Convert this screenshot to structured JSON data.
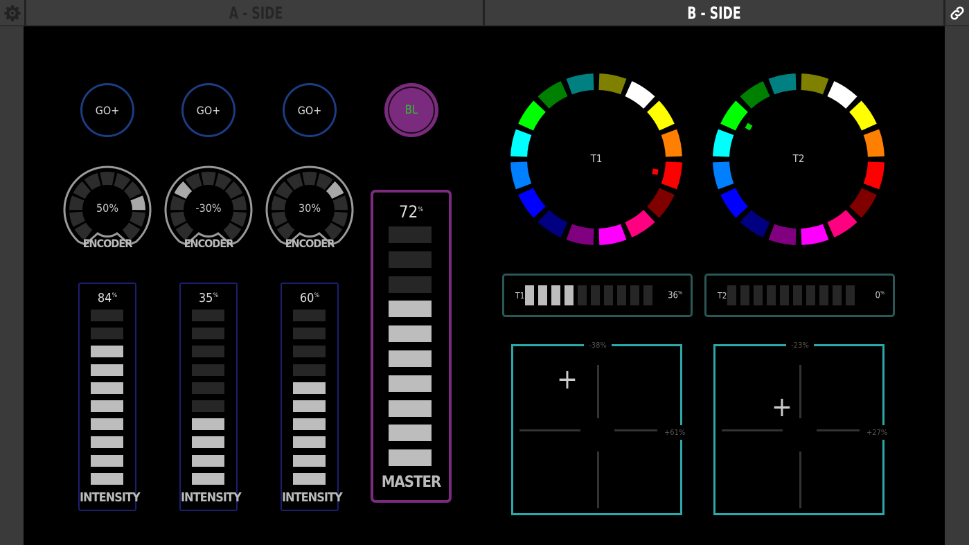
{
  "header": {
    "tab_a": "A - SIDE",
    "tab_b": "B - SIDE",
    "settings_icon": "gear-icon",
    "link_icon": "link-icon"
  },
  "buttons": [
    {
      "label": "GO+"
    },
    {
      "label": "GO+"
    },
    {
      "label": "GO+"
    },
    {
      "label": "BL"
    }
  ],
  "encoders": [
    {
      "value": 50,
      "display": "50%",
      "label": "ENCODER"
    },
    {
      "value": -30,
      "display": "-30%",
      "label": "ENCODER"
    },
    {
      "value": 30,
      "display": "30%",
      "label": "ENCODER"
    }
  ],
  "faders": [
    {
      "value": 84,
      "display": "84",
      "unit": "%",
      "label": "INTENSITY"
    },
    {
      "value": 35,
      "display": "35",
      "unit": "%",
      "label": "INTENSITY"
    },
    {
      "value": 60,
      "display": "60",
      "unit": "%",
      "label": "INTENSITY"
    }
  ],
  "master": {
    "value": 72,
    "display": "72",
    "unit": "%",
    "label": "MASTER"
  },
  "wheels": [
    {
      "label": "T1",
      "indicator": "#ff0000"
    },
    {
      "label": "T2",
      "indicator": "#00e000"
    }
  ],
  "wheel_colors": [
    "#808000",
    "#ffffff",
    "#ffff00",
    "#ff8000",
    "#ff0000",
    "#800000",
    "#ff0080",
    "#ff00ff",
    "#800080",
    "#000080",
    "#0000ff",
    "#0080ff",
    "#00ffff",
    "#00ff00",
    "#008000",
    "#008080"
  ],
  "tbars": [
    {
      "label": "T1",
      "value": 36,
      "display": "36",
      "unit": "%"
    },
    {
      "label": "T2",
      "value": 0,
      "display": "0",
      "unit": "%"
    }
  ],
  "pads": [
    {
      "y_display": "-38%",
      "x_display": "+61%"
    },
    {
      "y_display": "-23%",
      "x_display": "+27%"
    }
  ],
  "colors": {
    "accent_teal": "#2aa9a9",
    "master_purple": "#7b2b7d",
    "fader_navy": "#1c1f70",
    "go_blue": "#1c3d85"
  }
}
